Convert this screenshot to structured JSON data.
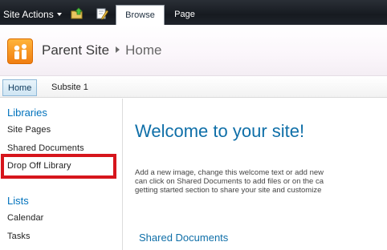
{
  "ribbon": {
    "site_actions_label": "Site Actions",
    "tabs": [
      {
        "label": "Browse"
      },
      {
        "label": "Page"
      }
    ],
    "icons": [
      "navigate-up-folder-icon",
      "edit-page-icon"
    ]
  },
  "title_area": {
    "breadcrumb_parent": "Parent Site",
    "breadcrumb_current": "Home"
  },
  "top_nav": {
    "items": [
      {
        "label": "Home",
        "selected": true
      },
      {
        "label": "Subsite 1",
        "selected": false
      }
    ]
  },
  "quick_launch": {
    "libraries_heading": "Libraries",
    "libraries": [
      "Site Pages",
      "Shared Documents",
      "Drop Off Library"
    ],
    "lists_heading": "Lists",
    "lists": [
      "Calendar",
      "Tasks"
    ],
    "highlight_color": "#d6151c"
  },
  "main": {
    "welcome_title": "Welcome to your site!",
    "description_lines": [
      "Add a new image, change this welcome text or add new",
      "can click on Shared Documents to add files or on the ca",
      "getting started section to share your site and customize"
    ],
    "shared_documents_title": "Shared Documents"
  },
  "colors": {
    "ribbon_bg": "#161a20",
    "link_blue": "#0072bc",
    "title_blue": "#0f6fa8",
    "logo_orange": "#f07e12"
  }
}
